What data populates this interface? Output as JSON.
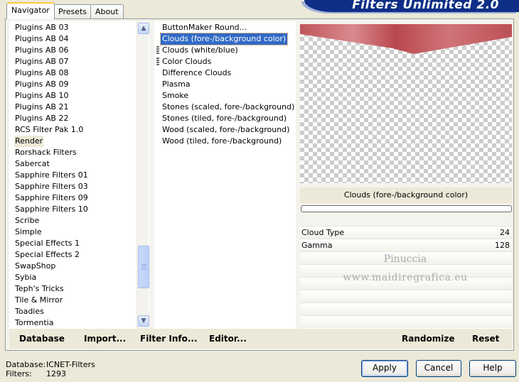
{
  "tabs": [
    "Navigator",
    "Presets",
    "About"
  ],
  "banner_title": "Filters Unlimited 2.0",
  "categories": [
    "Plugins AB 03",
    "Plugins AB 04",
    "Plugins AB 06",
    "Plugins AB 07",
    "Plugins AB 08",
    "Plugins AB 09",
    "Plugins AB 10",
    "Plugins AB 21",
    "Plugins AB 22",
    "RCS Filter Pak 1.0",
    "Render",
    "Rorshack Filters",
    "Sabercat",
    "Sapphire Filters 01",
    "Sapphire Filters 03",
    "Sapphire Filters 09",
    "Sapphire Filters 10",
    "Scribe",
    "Simple",
    "Special Effects 1",
    "Special Effects 2",
    "SwapShop",
    "Sybia",
    "Teph's Tricks",
    "Tile & Mirror",
    "Toadies",
    "Tormentia"
  ],
  "current_category": "Render",
  "filters": [
    "ButtonMaker Round...",
    "Clouds (fore-/background color)",
    "Clouds (white/blue)",
    "Color Clouds",
    "Difference Clouds",
    "Plasma",
    "Smoke",
    "Stones (scaled, fore-/background)",
    "Stones (tiled, fore-/background)",
    "Wood (scaled, fore-/background)",
    "Wood (tiled, fore-/background)"
  ],
  "selected_filter": "Clouds (fore-/background color)",
  "filter_name": "Clouds (fore-/background color)",
  "params": [
    {
      "label": "Cloud Type",
      "value": "24"
    },
    {
      "label": "Gamma",
      "value": "128"
    }
  ],
  "watermark": {
    "line1": "Pinuccia",
    "line2": "www.maidiregrafica.eu"
  },
  "bottom_buttons": {
    "database": "Database",
    "import": "Import...",
    "filter_info": "Filter Info...",
    "editor": "Editor...",
    "randomize": "Randomize",
    "reset": "Reset"
  },
  "status": {
    "database_label": "Database:",
    "database_value": "ICNET-Filters",
    "filters_label": "Filters:",
    "filters_value": "1293"
  },
  "dialog_buttons": {
    "apply": "Apply",
    "cancel": "Cancel",
    "help": "Help"
  },
  "icons": {
    "scroll_up": "scroll-up-icon",
    "scroll_down": "scroll-down-icon",
    "thumb_grip": "grip-icon"
  },
  "colors": {
    "selection": "#316ac5",
    "banner": "#0f2f86",
    "preview_cloud": "#c25a60"
  }
}
